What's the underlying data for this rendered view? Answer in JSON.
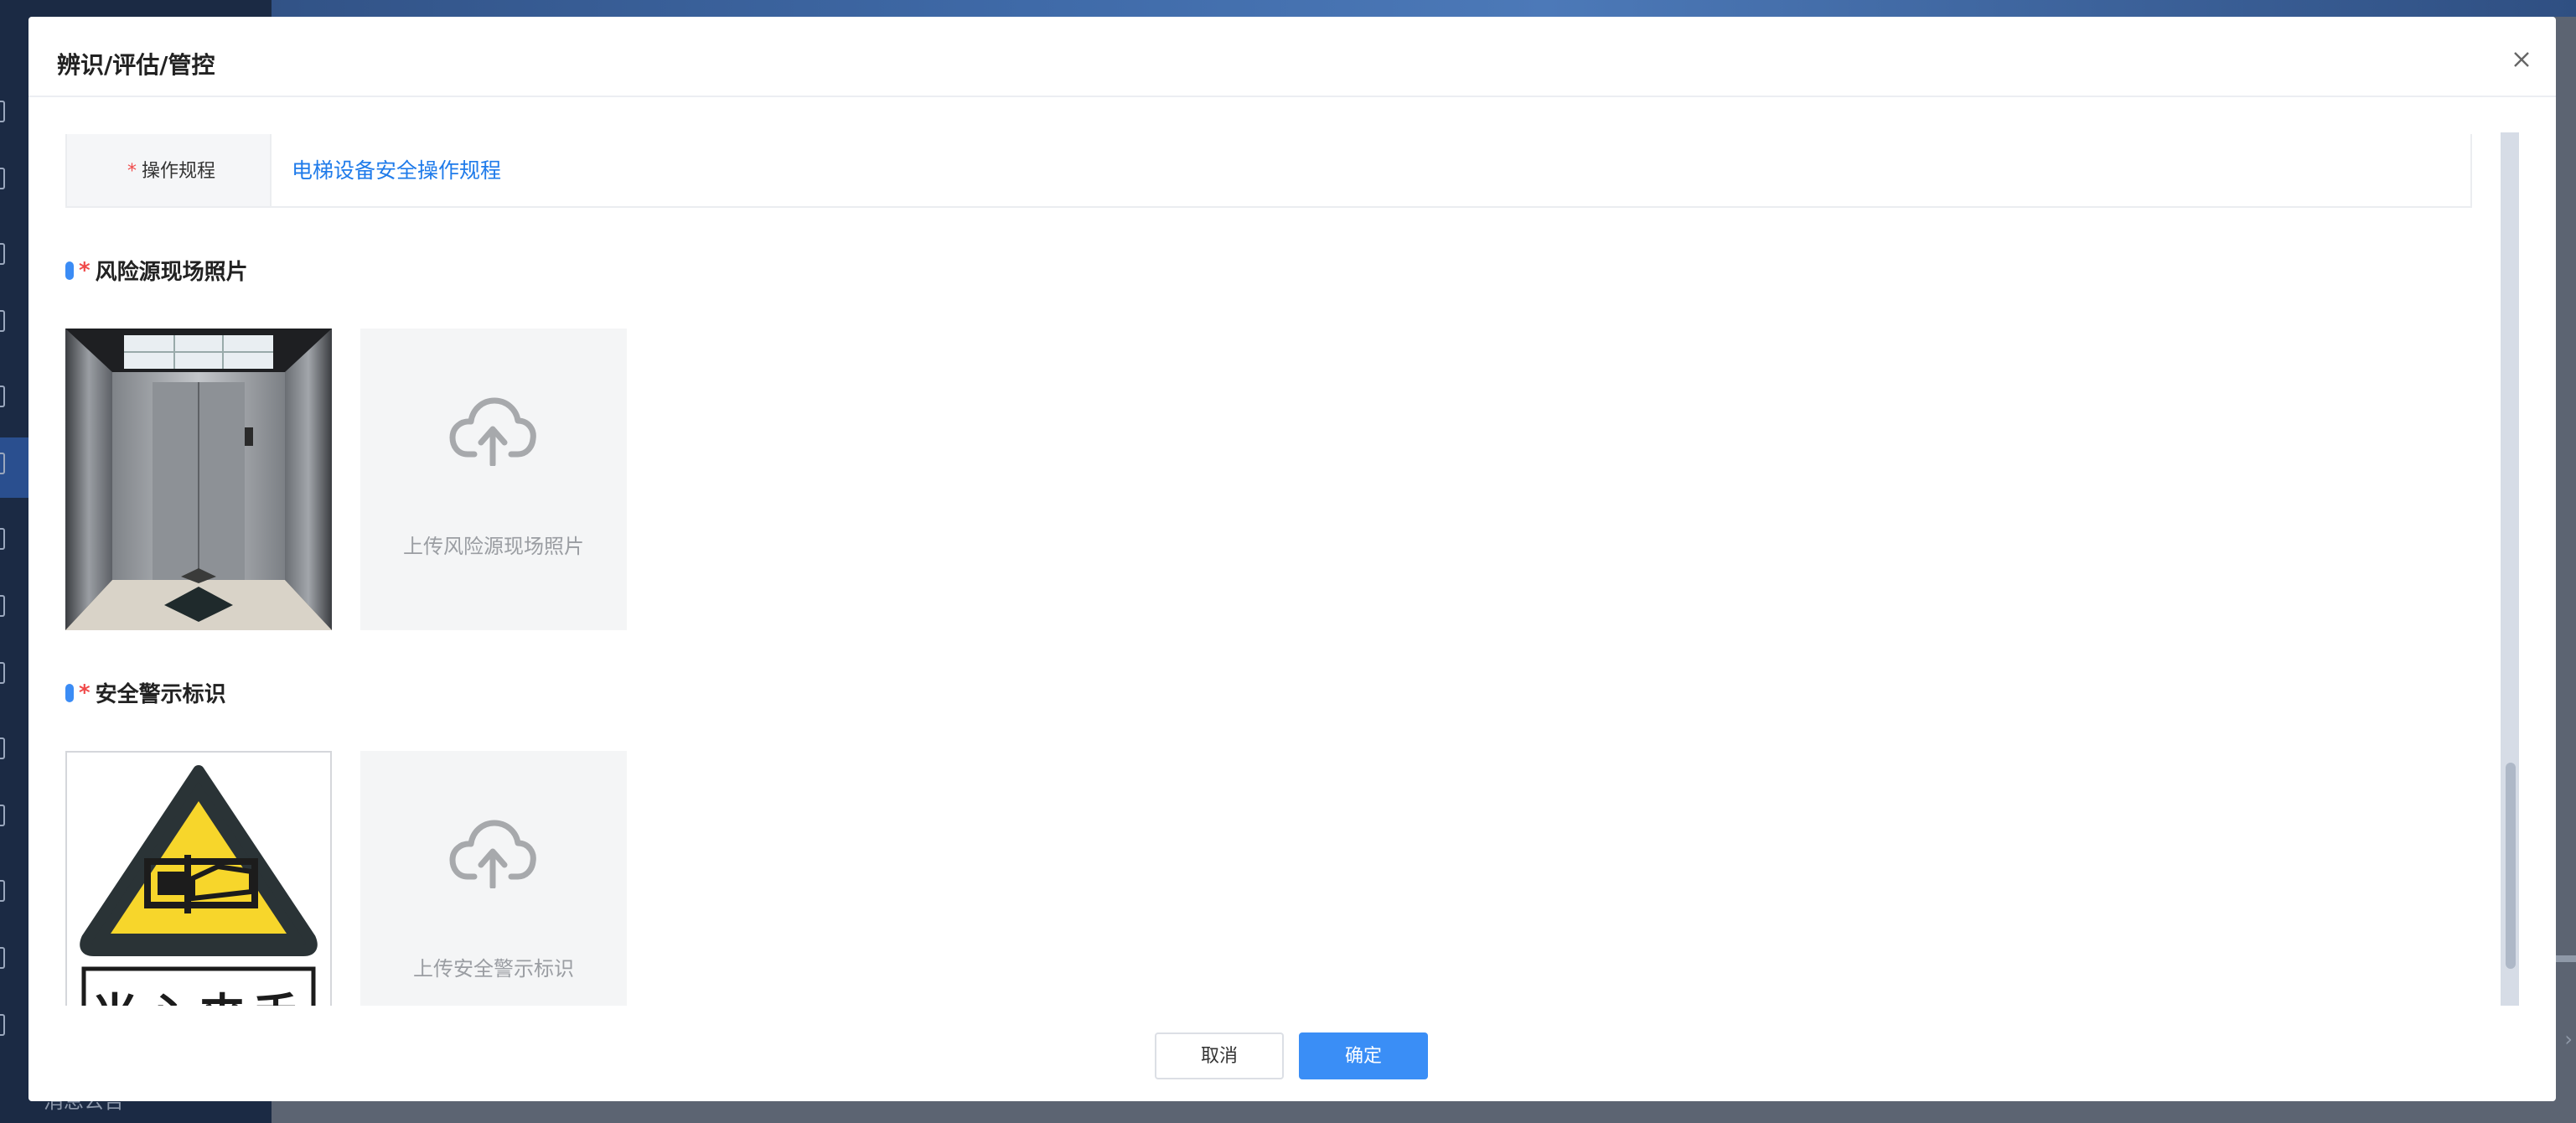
{
  "modal": {
    "title": "辨识/评估/管控"
  },
  "form": {
    "procedure_label": "操作规程",
    "procedure_value": "电梯设备安全操作规程"
  },
  "sections": {
    "site_photo": {
      "title": "风险源现场照片",
      "upload_text": "上传风险源现场照片"
    },
    "warning_sign": {
      "title": "安全警示标识",
      "upload_text": "上传安全警示标识",
      "sign_text": "当心夹手"
    }
  },
  "footer": {
    "cancel_label": "取消",
    "ok_label": "确定"
  },
  "background": {
    "sidebar_text": "消息公告"
  },
  "colors": {
    "accent": "#3a8ef6",
    "link": "#1f7bea",
    "required": "#f04a4a",
    "warning_yellow": "#f7d62b"
  }
}
